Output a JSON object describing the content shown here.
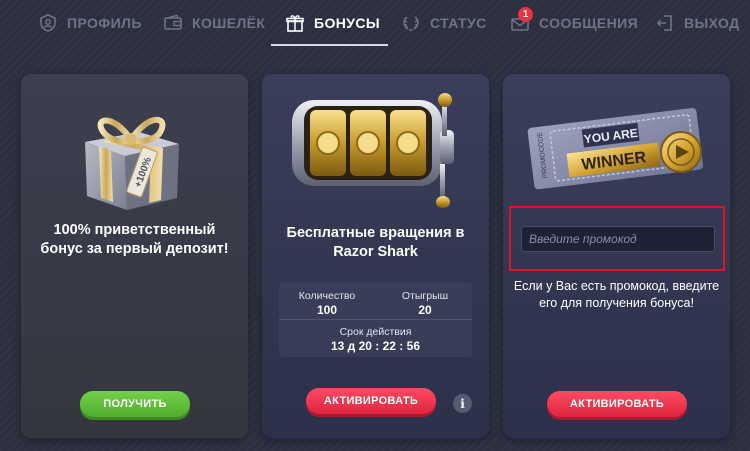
{
  "nav": {
    "items": [
      {
        "label": "ПРОФИЛЬ",
        "icon": "profile-shield-icon"
      },
      {
        "label": "КОШЕЛЁК",
        "icon": "wallet-icon"
      },
      {
        "label": "БОНУСЫ",
        "icon": "gift-icon",
        "active": true
      },
      {
        "label": "СТАТУС",
        "icon": "laurel-icon"
      },
      {
        "label": "СООБЩЕНИЯ",
        "icon": "envelope-icon",
        "badge": "1"
      },
      {
        "label": "ВЫХОД",
        "icon": "exit-door-icon"
      }
    ]
  },
  "cards": [
    {
      "title": "100% приветственный бонус за первый депозит!",
      "art_label": "+100%",
      "button": "ПОЛУЧИТЬ"
    },
    {
      "title": "Бесплатные вращения в Razor Shark",
      "stats": {
        "qty_label": "Количество",
        "qty_value": "100",
        "wager_label": "Отыгрыш",
        "wager_value": "20",
        "expiry_label": "Срок действия",
        "expiry_value": "13 д 20 : 22 : 56"
      },
      "button": "АКТИВИРОВАТЬ",
      "info": "i"
    },
    {
      "art_lines": [
        "YOU ARE",
        "WINNER"
      ],
      "art_side": "PROMOCODE",
      "input_placeholder": "Введите промокод",
      "input_value": "",
      "description": "Если у Вас есть промокод, введите его для получения бонуса!",
      "button": "АКТИВИРОВАТЬ"
    }
  ],
  "colors": {
    "background": "#2c2f3f",
    "card": "#34374d",
    "green_button": "#5cbf38",
    "red_button": "#f0334d",
    "highlight_border": "#e0141e",
    "badge": "#e8343f"
  }
}
